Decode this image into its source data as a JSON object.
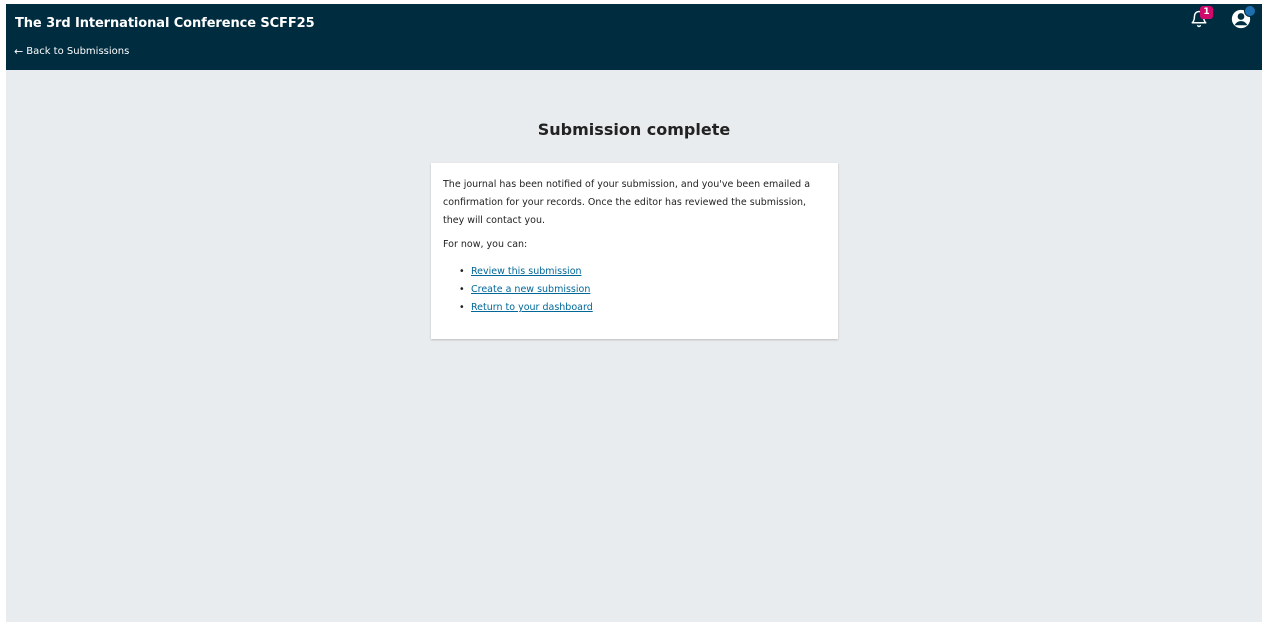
{
  "header": {
    "site_title": "The 3rd International Conference SCFF25",
    "back_label": "Back to Submissions",
    "notifications_count": "1"
  },
  "main": {
    "title": "Submission complete",
    "message": "The journal has been notified of your submission, and you've been emailed a confirmation for your records. Once the editor has reviewed the submission, they will contact you.",
    "options_intro": "For now, you can:",
    "links": [
      {
        "label": "Review this submission"
      },
      {
        "label": "Create a new submission"
      },
      {
        "label": "Return to your dashboard"
      }
    ]
  },
  "colors": {
    "header_bg": "#002c40",
    "page_bg": "#e9ecee",
    "link": "#006798",
    "badge": "#d00a6c"
  },
  "icons": {
    "notifications": "bell-icon",
    "user": "user-icon"
  }
}
